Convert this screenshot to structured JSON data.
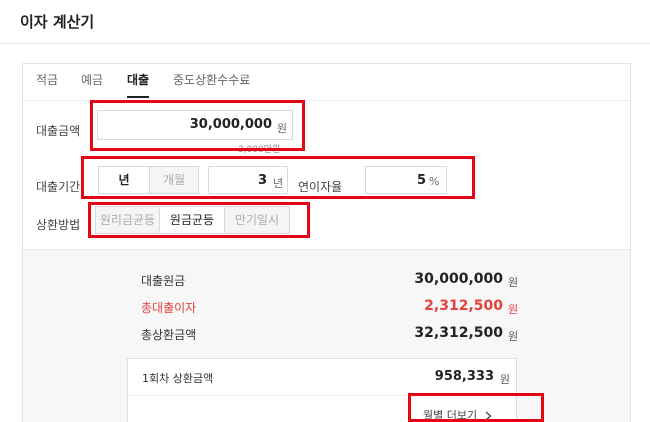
{
  "app": {
    "title": "이자 계산기"
  },
  "tabs": [
    {
      "label": "적금",
      "active": false
    },
    {
      "label": "예금",
      "active": false
    },
    {
      "label": "대출",
      "active": true
    },
    {
      "label": "중도상환수수료",
      "active": false
    }
  ],
  "loan_amount": {
    "label": "대출금액",
    "value": "30,000,000",
    "unit": "원",
    "hint": "3,000만원"
  },
  "loan_term": {
    "label": "대출기간",
    "unit_options": [
      "년",
      "개월"
    ],
    "selected_unit": "년",
    "value": "3",
    "unit": "년"
  },
  "interest_rate": {
    "label": "연이자율",
    "value": "5",
    "unit": "%"
  },
  "repayment": {
    "label": "상환방법",
    "options": [
      "원리금균등",
      "원금균등",
      "만기일시"
    ],
    "selected": "원금균등"
  },
  "results": {
    "principal": {
      "label": "대출원금",
      "value": "30,000,000",
      "unit": "원"
    },
    "total_interest": {
      "label": "총대출이자",
      "value": "2,312,500",
      "unit": "원"
    },
    "total_repayment": {
      "label": "총상환금액",
      "value": "32,312,500",
      "unit": "원"
    },
    "first_payment": {
      "label": "1회차 상환금액",
      "value": "958,333",
      "unit": "원"
    },
    "monthly_more": "월별 더보기",
    "more_icon": "chevron-right-icon"
  },
  "colors": {
    "highlight_box": "#e30613",
    "interest_red": "#e5403b"
  }
}
